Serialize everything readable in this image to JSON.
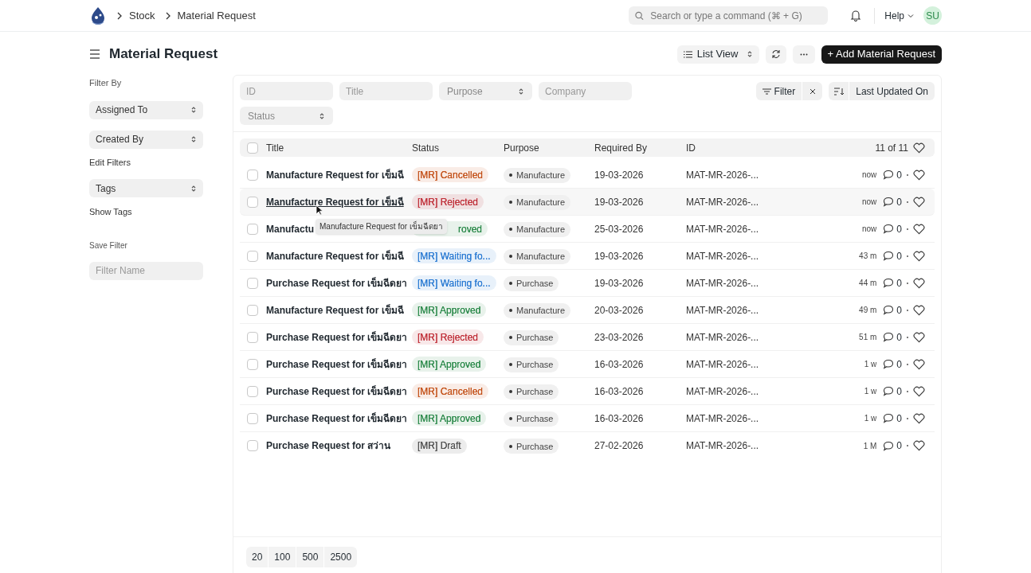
{
  "breadcrumbs": [
    "Stock",
    "Material Request"
  ],
  "search": {
    "placeholder": "Search or type a command (⌘ + G)"
  },
  "help": "Help",
  "avatar": "SU",
  "page_title": "Material Request",
  "toolbar": {
    "view": "List View",
    "primary": "+ Add Material Request"
  },
  "sidebar": {
    "heading": "Filter By",
    "filters": [
      "Assigned To",
      "Created By"
    ],
    "edit_filters": "Edit Filters",
    "tags": "Tags",
    "show_tags": "Show Tags",
    "save_heading": "Save Filter",
    "filter_name_placeholder": "Filter Name"
  },
  "filters": [
    {
      "kind": "text",
      "placeholder": "ID"
    },
    {
      "kind": "text",
      "placeholder": "Title"
    },
    {
      "kind": "select",
      "placeholder": "Purpose"
    },
    {
      "kind": "text",
      "placeholder": "Company"
    },
    {
      "kind": "select",
      "placeholder": "Status"
    }
  ],
  "filter_button": "Filter",
  "sort_button": "Last Updated On",
  "table": {
    "columns": [
      "Title",
      "Status",
      "Purpose",
      "Required By",
      "ID"
    ],
    "count": "11 of 11",
    "all_selected": false,
    "rows": [
      {
        "title": "Manufacture Request for เข็มฉี",
        "status": "[MR] Cancelled",
        "color": "#c4531c",
        "status_cut": false,
        "purpose": "Manufacture",
        "required_by": "19-03-2026",
        "id": "MAT-MR-2026-...",
        "modified": "now",
        "comments": "0",
        "hovered": false
      },
      {
        "title": "Manufacture Request for เข็มฉี",
        "status": "[MR] Rejected",
        "color": "#c0303a",
        "status_cut": false,
        "purpose": "Manufacture",
        "required_by": "19-03-2026",
        "id": "MAT-MR-2026-...",
        "modified": "now",
        "comments": "0",
        "hovered": true
      },
      {
        "title": "Manufactu",
        "status": "roved",
        "color": "#2c8a4b",
        "status_cut": true,
        "purpose": "Manufacture",
        "required_by": "25-03-2026",
        "id": "MAT-MR-2026-...",
        "modified": "now",
        "comments": "0",
        "hovered": false
      },
      {
        "title": "Manufacture Request for เข็มฉี",
        "status": "[MR] Waiting fo...",
        "color": "#2b7bd3",
        "status_cut": false,
        "purpose": "Manufacture",
        "required_by": "19-03-2026",
        "id": "MAT-MR-2026-...",
        "modified": "43 m",
        "comments": "0",
        "hovered": false
      },
      {
        "title": "Purchase Request for เข็มฉีดยา",
        "status": "[MR] Waiting fo...",
        "color": "#2b7bd3",
        "status_cut": false,
        "purpose": "Purchase",
        "required_by": "19-03-2026",
        "id": "MAT-MR-2026-...",
        "modified": "44 m",
        "comments": "0",
        "hovered": false
      },
      {
        "title": "Manufacture Request for เข็มฉี",
        "status": "[MR] Approved",
        "color": "#2c8a4b",
        "status_cut": false,
        "purpose": "Manufacture",
        "required_by": "20-03-2026",
        "id": "MAT-MR-2026-...",
        "modified": "49 m",
        "comments": "0",
        "hovered": false
      },
      {
        "title": "Purchase Request for เข็มฉีดยา",
        "status": "[MR] Rejected",
        "color": "#c0303a",
        "status_cut": false,
        "purpose": "Purchase",
        "required_by": "23-03-2026",
        "id": "MAT-MR-2026-...",
        "modified": "51 m",
        "comments": "0",
        "hovered": false
      },
      {
        "title": "Purchase Request for เข็มฉีดยา",
        "status": "[MR] Approved",
        "color": "#2c8a4b",
        "status_cut": false,
        "purpose": "Purchase",
        "required_by": "16-03-2026",
        "id": "MAT-MR-2026-...",
        "modified": "1 w",
        "comments": "0",
        "hovered": false
      },
      {
        "title": "Purchase Request for เข็มฉีดยา",
        "status": "[MR] Cancelled",
        "color": "#c4531c",
        "status_cut": false,
        "purpose": "Purchase",
        "required_by": "16-03-2026",
        "id": "MAT-MR-2026-...",
        "modified": "1 w",
        "comments": "0",
        "hovered": false
      },
      {
        "title": "Purchase Request for เข็มฉีดยา",
        "status": "[MR] Approved",
        "color": "#2c8a4b",
        "status_cut": false,
        "purpose": "Purchase",
        "required_by": "16-03-2026",
        "id": "MAT-MR-2026-...",
        "modified": "1 w",
        "comments": "0",
        "hovered": false
      },
      {
        "title": "Purchase Request for สว่าน",
        "status": "[MR] Draft",
        "color": "#525252",
        "status_cut": false,
        "purpose": "Purchase",
        "required_by": "27-02-2026",
        "id": "MAT-MR-2026-...",
        "modified": "1 M",
        "comments": "0",
        "hovered": false
      }
    ]
  },
  "tooltip": "Manufacture Request for เข็มฉีดยา",
  "page_sizes": [
    "20",
    "100",
    "500",
    "2500"
  ]
}
